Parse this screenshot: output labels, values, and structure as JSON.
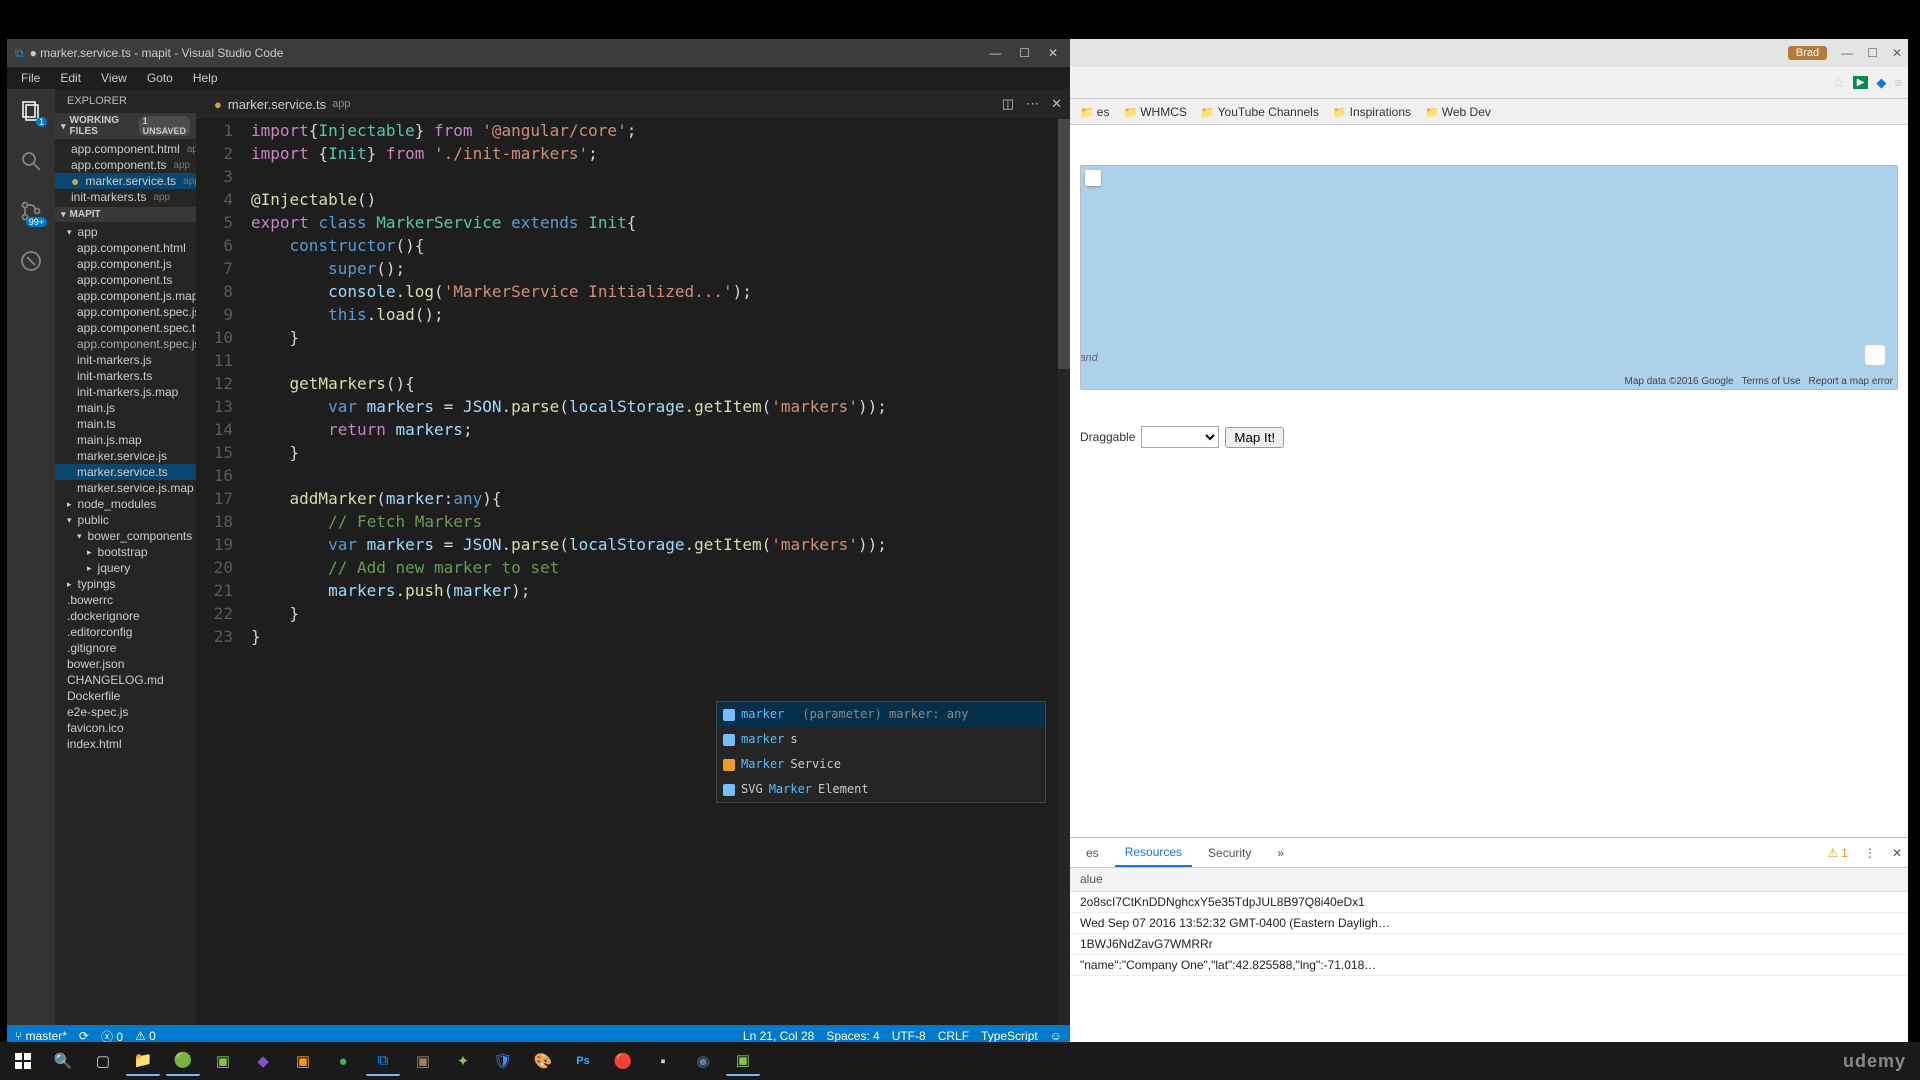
{
  "title": "● marker.service.ts - mapit - Visual Studio Code",
  "menu": [
    "File",
    "Edit",
    "View",
    "Goto",
    "Help"
  ],
  "explorer": {
    "header": "EXPLORER",
    "working": {
      "label": "WORKING FILES",
      "badge": "1 UNSAVED"
    },
    "workingFiles": [
      {
        "name": "app.component.html",
        "ext": "app",
        "dirty": false
      },
      {
        "name": "app.component.ts",
        "ext": "app",
        "dirty": false
      },
      {
        "name": "marker.service.ts",
        "ext": "app",
        "dirty": true,
        "selected": true
      },
      {
        "name": "init-markers.ts",
        "ext": "app",
        "dirty": false
      }
    ],
    "project": "MAPIT",
    "tree": [
      {
        "name": "app",
        "folder": true,
        "open": true,
        "children": [
          {
            "name": "app.component.html"
          },
          {
            "name": "app.component.js"
          },
          {
            "name": "app.component.ts"
          },
          {
            "name": "app.component.js.map"
          },
          {
            "name": "app.component.spec.js"
          },
          {
            "name": "app.component.spec.ts"
          },
          {
            "name": "app.component.spec.js...",
            "dim": true
          },
          {
            "name": "init-markers.js"
          },
          {
            "name": "init-markers.ts"
          },
          {
            "name": "init-markers.js.map"
          },
          {
            "name": "main.js"
          },
          {
            "name": "main.ts"
          },
          {
            "name": "main.js.map"
          },
          {
            "name": "marker.service.js"
          },
          {
            "name": "marker.service.ts",
            "selected": true
          },
          {
            "name": "marker.service.js.map"
          }
        ]
      },
      {
        "name": "node_modules",
        "folder": true,
        "open": false
      },
      {
        "name": "public",
        "folder": true,
        "open": true,
        "children": [
          {
            "name": "bower_components",
            "folder": true,
            "open": true,
            "children": [
              {
                "name": "bootstrap",
                "folder": true
              },
              {
                "name": "jquery",
                "folder": true
              }
            ]
          }
        ]
      },
      {
        "name": "typings",
        "folder": true,
        "open": false
      },
      {
        "name": ".bowerrc"
      },
      {
        "name": ".dockerignore"
      },
      {
        "name": ".editorconfig"
      },
      {
        "name": ".gitignore"
      },
      {
        "name": "bower.json"
      },
      {
        "name": "CHANGELOG.md"
      },
      {
        "name": "Dockerfile"
      },
      {
        "name": "e2e-spec.js"
      },
      {
        "name": "favicon.ico"
      },
      {
        "name": "index.html"
      }
    ]
  },
  "tab": {
    "name": "marker.service.ts",
    "ext": "app"
  },
  "code": [
    {
      "n": 1,
      "t": [
        [
          "kw",
          "import"
        ],
        [
          "",
          ""
        ],
        [
          "",
          "{"
        ],
        [
          "cls",
          "Injectable"
        ],
        [
          "",
          "} "
        ],
        [
          "kw",
          "from"
        ],
        [
          "",
          " "
        ],
        [
          "str",
          "'@angular/core'"
        ],
        [
          "",
          ";"
        ]
      ]
    },
    {
      "n": 2,
      "t": [
        [
          "kw",
          "import"
        ],
        [
          "",
          " {"
        ],
        [
          "cls",
          "Init"
        ],
        [
          "",
          "} "
        ],
        [
          "kw",
          "from"
        ],
        [
          "",
          " "
        ],
        [
          "str",
          "'./init-markers'"
        ],
        [
          "",
          ";"
        ]
      ]
    },
    {
      "n": 3,
      "t": []
    },
    {
      "n": 4,
      "t": [
        [
          "dec",
          "@Injectable"
        ],
        [
          "",
          "()"
        ]
      ]
    },
    {
      "n": 5,
      "t": [
        [
          "kw",
          "export"
        ],
        [
          "",
          " "
        ],
        [
          "type",
          "class"
        ],
        [
          "",
          " "
        ],
        [
          "cls",
          "MarkerService"
        ],
        [
          "",
          " "
        ],
        [
          "type",
          "extends"
        ],
        [
          "",
          " "
        ],
        [
          "cls",
          "Init"
        ],
        [
          "",
          "{"
        ]
      ]
    },
    {
      "n": 6,
      "t": [
        [
          "",
          "    "
        ],
        [
          "type",
          "constructor"
        ],
        [
          "",
          "(){"
        ]
      ]
    },
    {
      "n": 7,
      "t": [
        [
          "",
          "        "
        ],
        [
          "type",
          "super"
        ],
        [
          "",
          "();"
        ]
      ]
    },
    {
      "n": 8,
      "t": [
        [
          "",
          "        "
        ],
        [
          "var",
          "console"
        ],
        [
          "",
          "."
        ],
        [
          "fn",
          "log"
        ],
        [
          "",
          "("
        ],
        [
          "str",
          "'MarkerService Initialized...'"
        ],
        [
          "",
          ");"
        ]
      ]
    },
    {
      "n": 9,
      "t": [
        [
          "",
          "        "
        ],
        [
          "this",
          "this"
        ],
        [
          "",
          "."
        ],
        [
          "fn",
          "load"
        ],
        [
          "",
          "();"
        ]
      ]
    },
    {
      "n": 10,
      "t": [
        [
          "",
          "    }"
        ]
      ]
    },
    {
      "n": 11,
      "t": []
    },
    {
      "n": 12,
      "t": [
        [
          "",
          "    "
        ],
        [
          "fn",
          "getMarkers"
        ],
        [
          "",
          "(){"
        ]
      ]
    },
    {
      "n": 13,
      "t": [
        [
          "",
          "        "
        ],
        [
          "type",
          "var"
        ],
        [
          "",
          " "
        ],
        [
          "var",
          "markers"
        ],
        [
          "",
          " = "
        ],
        [
          "var",
          "JSON"
        ],
        [
          "",
          "."
        ],
        [
          "fn",
          "parse"
        ],
        [
          "",
          "("
        ],
        [
          "var",
          "localStorage"
        ],
        [
          "",
          "."
        ],
        [
          "fn",
          "getItem"
        ],
        [
          "",
          "("
        ],
        [
          "str",
          "'markers'"
        ],
        [
          "",
          "));"
        ]
      ]
    },
    {
      "n": 14,
      "t": [
        [
          "",
          "        "
        ],
        [
          "kw",
          "return"
        ],
        [
          "",
          " "
        ],
        [
          "var",
          "markers"
        ],
        [
          "",
          ";"
        ]
      ]
    },
    {
      "n": 15,
      "t": [
        [
          "",
          "    }"
        ]
      ]
    },
    {
      "n": 16,
      "t": []
    },
    {
      "n": 17,
      "t": [
        [
          "",
          "    "
        ],
        [
          "fn",
          "addMarker"
        ],
        [
          "",
          "("
        ],
        [
          "var",
          "marker"
        ],
        [
          "",
          ":"
        ],
        [
          "type",
          "any"
        ],
        [
          "",
          "){"
        ]
      ]
    },
    {
      "n": 18,
      "t": [
        [
          "",
          "        "
        ],
        [
          "com",
          "// Fetch Markers"
        ]
      ]
    },
    {
      "n": 19,
      "t": [
        [
          "",
          "        "
        ],
        [
          "type",
          "var"
        ],
        [
          "",
          " "
        ],
        [
          "var",
          "markers"
        ],
        [
          "",
          " = "
        ],
        [
          "var",
          "JSON"
        ],
        [
          "",
          "."
        ],
        [
          "fn",
          "parse"
        ],
        [
          "",
          "("
        ],
        [
          "var",
          "localStorage"
        ],
        [
          "",
          "."
        ],
        [
          "fn",
          "getItem"
        ],
        [
          "",
          "("
        ],
        [
          "str",
          "'markers'"
        ],
        [
          "",
          "));"
        ]
      ]
    },
    {
      "n": 20,
      "t": [
        [
          "",
          "        "
        ],
        [
          "com",
          "// Add new marker to set"
        ]
      ]
    },
    {
      "n": 21,
      "t": [
        [
          "",
          "        "
        ],
        [
          "var",
          "markers"
        ],
        [
          "",
          "."
        ],
        [
          "fn",
          "push"
        ],
        [
          "",
          "("
        ],
        [
          "var",
          "marker"
        ],
        [
          "",
          ");"
        ]
      ]
    },
    {
      "n": 22,
      "t": [
        [
          "",
          "    }"
        ]
      ]
    },
    {
      "n": 23,
      "t": [
        [
          "",
          "}"
        ]
      ]
    }
  ],
  "intellisense": [
    {
      "icon": "v",
      "hl": "marker",
      "rest": "",
      "sig": "(parameter) marker: any",
      "sel": true
    },
    {
      "icon": "v",
      "hl": "marker",
      "rest": "s"
    },
    {
      "icon": "c",
      "hl": "Marker",
      "rest": "Service"
    },
    {
      "icon": "v",
      "hl": "",
      "pre": "SVG",
      "hl2": "Marker",
      "rest": "Element"
    }
  ],
  "status": {
    "branch": "master",
    "errors": "0",
    "warnings": "0",
    "pos": "Ln 21, Col 28",
    "spaces": "Spaces: 4",
    "encoding": "UTF-8",
    "eol": "CRLF",
    "lang": "TypeScript"
  },
  "browser": {
    "user": "Brad",
    "bookmarks": [
      "es",
      "WHMCS",
      "YouTube Channels",
      "Inspirations",
      "Web Dev"
    ],
    "map": {
      "label": "land",
      "attrib": [
        "Map data ©2016 Google",
        "Terms of Use",
        "Report a map error"
      ]
    },
    "controls": {
      "label": "Draggable",
      "button": "Map It!"
    },
    "devtools": {
      "tabs": [
        "es",
        "Resources",
        "Security",
        "»"
      ],
      "active": "Resources",
      "warncount": "1",
      "valuehdr": "alue",
      "rows": [
        "2o8scI7CtKnDDNghcxY5e35TdpJUL8B97Q8i40eDx1",
        "Wed Sep 07 2016 13:52:32 GMT-0400 (Eastern Dayligh…",
        "1BWJ6NdZavG7WMRRr",
        "\"name\":\"Company One\",\"lat\":42.825588,\"lng\":-71.018…"
      ]
    }
  },
  "udemy": "udemy"
}
